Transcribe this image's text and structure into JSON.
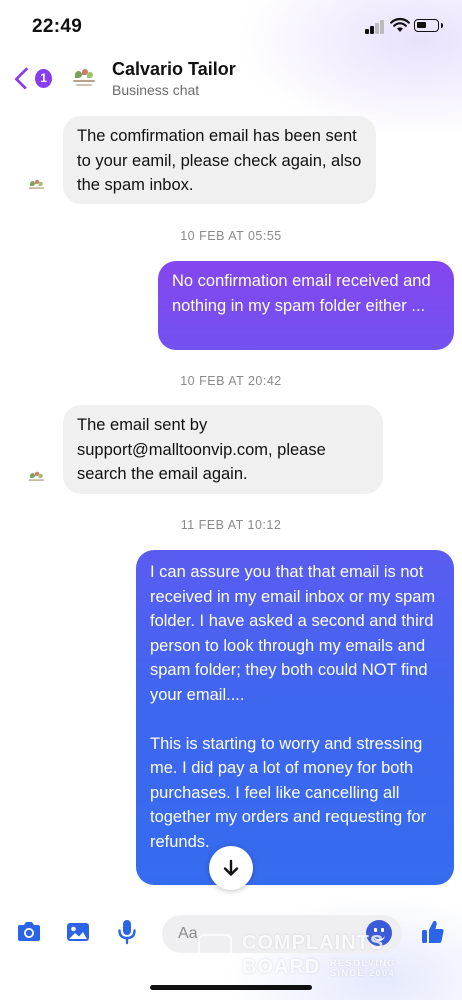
{
  "status_bar": {
    "time": "22:49"
  },
  "header": {
    "back_badge": "1",
    "title": "Calvario Tailor",
    "subtitle": "Business chat"
  },
  "messages": [
    {
      "direction": "in",
      "text": "The comfirmation email has been sent to your eamil, please check again, also the spam inbox."
    },
    {
      "direction": "out",
      "text": "No confirmation email received and nothing in my spam folder either ..."
    },
    {
      "direction": "in",
      "text": "The email sent by support@malltoonvip.com, please search the email again."
    },
    {
      "direction": "out",
      "text": "I can assure you that that email is not received in my email inbox or my spam folder. I have asked a second and third person to look through my emails and  spam folder; they both could NOT find your email....\n\nThis is starting to worry and stressing me. I did pay a lot of money for both purchases. I feel like cancelling all together my orders and requesting for refunds."
    }
  ],
  "timestamps": [
    "10 FEB AT 05:55",
    "10 FEB AT 20:42",
    "11 FEB AT 10:12"
  ],
  "composer": {
    "placeholder": "Aa"
  },
  "watermark": {
    "line1": "COMPLAINTS",
    "line2": "BOARD",
    "tagline1": "RESOLVING",
    "tagline2": "SINCE 2004"
  },
  "colors": {
    "accent": "#8a3cf0",
    "out_bubble_purple": "#7b4ff0",
    "out_bubble_blue": "#3d6af0",
    "composer_icons": "#2b64e6",
    "incoming_bubble": "#f0f0f0"
  },
  "icons": {
    "back": "chevron-left-icon",
    "camera": "camera-icon",
    "gallery": "image-icon",
    "mic": "microphone-icon",
    "emoji": "emoji-icon",
    "like": "thumbs-up-icon",
    "scroll": "arrow-down-icon"
  }
}
